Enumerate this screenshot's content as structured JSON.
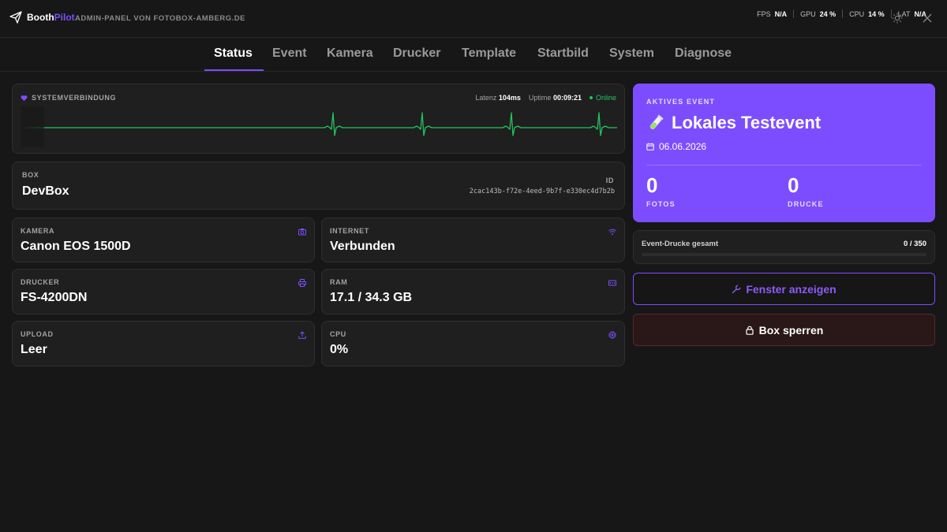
{
  "header": {
    "brand_part1": "Booth",
    "brand_part2": "Pilot",
    "subtitle": "ADMIN-PANEL VON FOTOBOX-AMBERG.DE",
    "stats": [
      {
        "label": "FPS",
        "value": "N/A"
      },
      {
        "label": "GPU",
        "value": "24 %"
      },
      {
        "label": "CPU",
        "value": "14 %"
      },
      {
        "label": "LAT",
        "value": "N/A"
      }
    ]
  },
  "tabs": [
    "Status",
    "Event",
    "Kamera",
    "Drucker",
    "Template",
    "Startbild",
    "System",
    "Diagnose"
  ],
  "active_tab": "Status",
  "system": {
    "title": "SYSTEMVERBINDUNG",
    "latency_label": "Latenz",
    "latency_value": "104ms",
    "uptime_label": "Uptime",
    "uptime_value": "00:09:21",
    "status": "Online"
  },
  "box": {
    "label": "BOX",
    "name": "DevBox",
    "id_label": "ID",
    "id_value": "2cac143b-f72e-4eed-9b7f-e330ec4d7b2b"
  },
  "tiles": {
    "kamera": {
      "label": "KAMERA",
      "value": "Canon EOS 1500D",
      "icon": "camera-icon"
    },
    "internet": {
      "label": "INTERNET",
      "value": "Verbunden",
      "icon": "wifi-icon"
    },
    "drucker": {
      "label": "DRUCKER",
      "value": "FS-4200DN",
      "icon": "printer-icon"
    },
    "ram": {
      "label": "RAM",
      "value": "17.1 / 34.3 GB",
      "icon": "memory-icon"
    },
    "upload": {
      "label": "UPLOAD",
      "value": "Leer",
      "icon": "upload-icon"
    },
    "cpu": {
      "label": "CPU",
      "value": "0%",
      "icon": "chip-icon"
    }
  },
  "event": {
    "label": "AKTIVES EVENT",
    "title": "Lokales Testevent",
    "date": "06.06.2026",
    "photos_value": "0",
    "photos_label": "FOTOS",
    "prints_value": "0",
    "prints_label": "DRUCKE"
  },
  "prints_total": {
    "label": "Event-Drucke gesamt",
    "count": "0 / 350",
    "fraction": 0
  },
  "buttons": {
    "window": "Fenster anzeigen",
    "lock": "Box sperren"
  },
  "colors": {
    "accent": "#7c4dff",
    "online": "#22c55e",
    "ecg": "#22c55e"
  }
}
